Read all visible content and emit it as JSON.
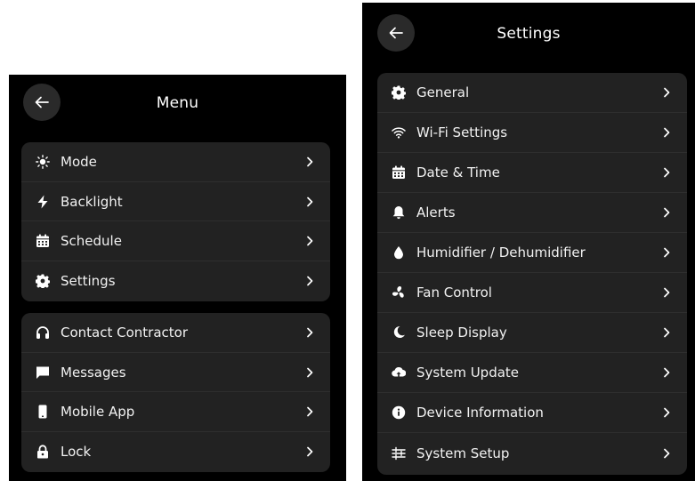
{
  "menu": {
    "title": "Menu",
    "group1": [
      {
        "label": "Mode",
        "icon": "sun-icon"
      },
      {
        "label": "Backlight",
        "icon": "bolt-icon"
      },
      {
        "label": "Schedule",
        "icon": "calendar-icon"
      },
      {
        "label": "Settings",
        "icon": "gear-icon"
      }
    ],
    "group2": [
      {
        "label": "Contact Contractor",
        "icon": "headphones-icon"
      },
      {
        "label": "Messages",
        "icon": "message-icon"
      },
      {
        "label": "Mobile App",
        "icon": "phone-icon"
      },
      {
        "label": "Lock",
        "icon": "lock-icon"
      }
    ]
  },
  "settings": {
    "title": "Settings",
    "items": [
      {
        "label": "General",
        "icon": "gear-icon"
      },
      {
        "label": "Wi-Fi Settings",
        "icon": "wifi-icon"
      },
      {
        "label": "Date & Time",
        "icon": "calendar-icon"
      },
      {
        "label": "Alerts",
        "icon": "bell-icon"
      },
      {
        "label": "Humidifier / Dehumidifier",
        "icon": "droplet-icon"
      },
      {
        "label": "Fan Control",
        "icon": "fan-icon"
      },
      {
        "label": "Sleep Display",
        "icon": "moon-icon"
      },
      {
        "label": "System Update",
        "icon": "cloud-upload-icon"
      },
      {
        "label": "Device Information",
        "icon": "info-icon"
      },
      {
        "label": "System Setup",
        "icon": "sliders-icon"
      }
    ]
  },
  "colors": {
    "panel_bg": "#000000",
    "group_bg": "#222222",
    "text": "#f2f2f2",
    "back_button_bg": "#2a2a2a"
  }
}
